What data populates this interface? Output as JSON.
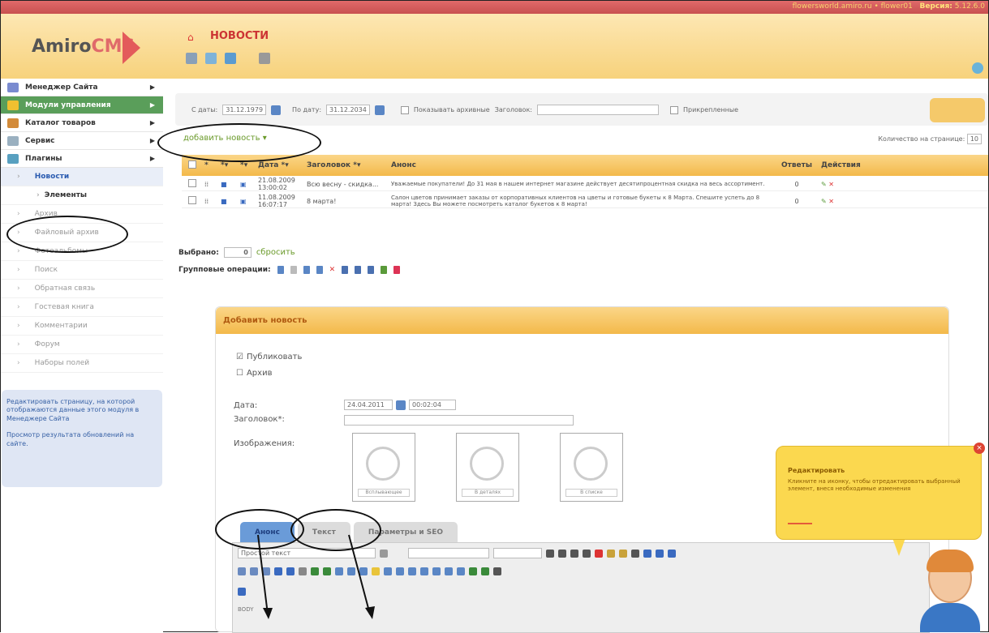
{
  "topbar": {
    "site": "flowersworld.amiro.ru • flower01",
    "version_label": "Версия:",
    "version": "5.12.6.0"
  },
  "header": {
    "logo_amiro": "Amiro",
    "logo_cms": "CMS",
    "section_title": "НОВОСТИ"
  },
  "sidebar": {
    "items": [
      {
        "label": "Менеджер Сайта",
        "color": "#7a8bd0"
      },
      {
        "label": "Модули управления",
        "color": "#f0c030"
      },
      {
        "label": "Каталог товаров",
        "color": "#d38b3a"
      },
      {
        "label": "Сервис",
        "color": "#9ab0c0"
      },
      {
        "label": "Плагины",
        "color": "#58a0c0"
      }
    ],
    "current": "Новости",
    "elements": "Элементы",
    "subs": [
      "Архив",
      "Файловый архив",
      "Фотоальбомы",
      "Поиск",
      "Обратная связь",
      "Гостевая книга",
      "Комментарии",
      "Форум",
      "Наборы полей"
    ],
    "box_text1": "Редактировать страницу, на которой отображаются данные этого модуля в Менеджере Сайта",
    "box_text2": "Просмотр результата обновлений на сайте."
  },
  "filter": {
    "from_label": "С даты:",
    "from": "31.12.1979",
    "to_label": "По дату:",
    "to": "31.12.2034",
    "versions_label": "Показывать архивные",
    "title_label": "Заголовок:",
    "pinned_label": "Прикрепленные"
  },
  "list": {
    "add_link": "добавить новость",
    "perpage_label": "Количество на странице:",
    "perpage": "10",
    "headers": {
      "date": "Дата",
      "title": "Заголовок",
      "announce": "Анонс",
      "answers": "Ответы",
      "actions": "Действия"
    },
    "rows": [
      {
        "date": "21.08.2009 13:00:02",
        "title": "Всю весну - скидка...",
        "announce": "Уважаемые покупатели! До 31 мая в нашем интернет магазине действует десятипроцентная скидка на весь ассортимент.",
        "answers": "0"
      },
      {
        "date": "11.08.2009 16:07:17",
        "title": "8 марта!",
        "announce": "Салон цветов принимает заказы от корпоративных клиентов на цветы и готовые букеты к 8 Марта. Спешите успеть до 8 марта! Здесь Вы можете посмотреть каталог букетов к 8 марта!",
        "answers": "0"
      }
    ],
    "selected_label": "Выбрано:",
    "selected": "0",
    "reset": "сбросить",
    "group_label": "Групповые операции:"
  },
  "form": {
    "title": "Добавить новость",
    "publish": "Публиковать",
    "archive": "Архив",
    "date_label": "Дата:",
    "date": "24.04.2011",
    "time": "00:02:04",
    "title_label": "Заголовок*:",
    "images_label": "Изображения:",
    "img_labels": [
      "Всплывающее",
      "В деталях",
      "В списке"
    ],
    "tabs": [
      "Анонс",
      "Текст",
      "Параметры и SEO"
    ],
    "format": "Простой текст",
    "body_tag": "BODY"
  },
  "tooltip": {
    "title": "Редактировать",
    "text": "Кликните на иконку, чтобы отредактировать выбранный элемент, внеся необходимые изменения"
  }
}
